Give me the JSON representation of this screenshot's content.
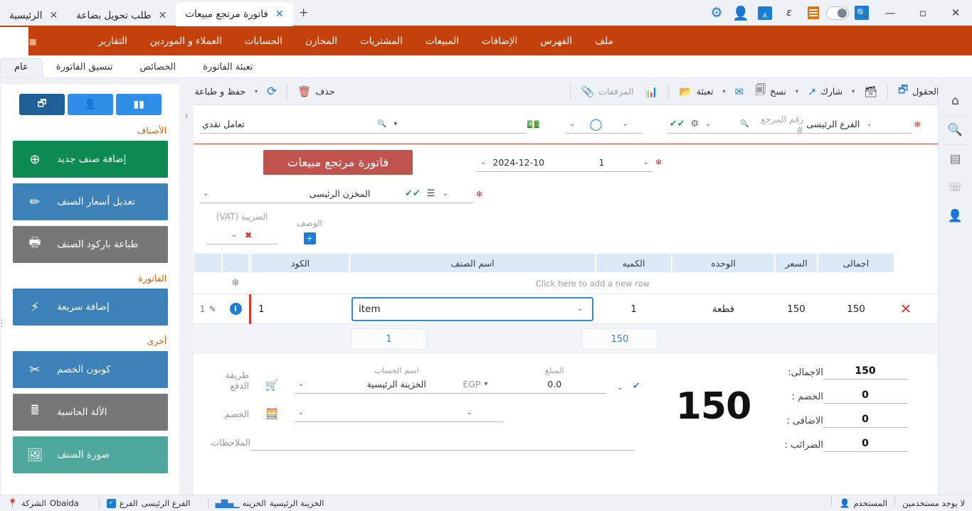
{
  "titlebar": {
    "window_controls": [
      "close",
      "maximize",
      "minimize"
    ],
    "quick_icons": [
      "search-icon",
      "toggle-switch",
      "list-orange-icon",
      "epsilon-icon",
      "translate-icon",
      "user-icon",
      "settings-gear-icon"
    ],
    "tabs": [
      {
        "label": "الرئيسية",
        "active": false
      },
      {
        "label": "طلب تحويل بضاعة",
        "active": false
      },
      {
        "label": "فاتورة مرتجع مبيعات",
        "active": true
      }
    ],
    "new_tab_label": "+"
  },
  "menubar": {
    "items": [
      "ملف",
      "الفهرس",
      "الإضافات",
      "المبيعات",
      "المشتريات",
      "المخازن",
      "الحسابات",
      "العملاء و الموردين",
      "التقارير"
    ]
  },
  "ribbon_tabs": [
    {
      "label": "عام",
      "active": true
    },
    {
      "label": "تنسيق الفاتورة",
      "active": false
    },
    {
      "label": "الخصائص",
      "active": false
    },
    {
      "label": "تعبئة الفاتورة",
      "active": false
    }
  ],
  "toolbar": {
    "new_label": "",
    "forward_label": "",
    "back_label": "",
    "zoom_label": "",
    "save_label": "حفظ",
    "save_print_label": "حفظ و طباعة",
    "refresh_label": "",
    "delete_label": "حذف",
    "attachments_label": "المرفقات",
    "chart_label": "",
    "fill_label": "تعبئة",
    "mail_label": "",
    "copy_label": "نسخ",
    "share_label": "شارك",
    "card_label": "",
    "choose_fields_label": "إختيار الحقول"
  },
  "rail": {
    "icons": [
      "home-icon",
      "search-icon",
      "report-icon",
      "phone-icon",
      "contact-icon"
    ]
  },
  "sidebar": {
    "tabs": [
      "chart-icon",
      "person-icon",
      "window-icon"
    ],
    "groups": [
      {
        "heading": "الأصناف",
        "buttons": [
          {
            "label": "إضافة صنف جديد",
            "icon": "plus-circle-icon",
            "color": "#0c8a52"
          },
          {
            "label": "تعديل أسعار الصنف",
            "icon": "pencil-icon",
            "color": "#3c81b8"
          },
          {
            "label": "طباعة باركود الصنف",
            "icon": "printer-icon",
            "color": "#777777"
          }
        ]
      },
      {
        "heading": "الفاتورة",
        "buttons": [
          {
            "label": "إضافة سريعة",
            "icon": "lightning-icon",
            "color": "#3c81b8"
          }
        ]
      },
      {
        "heading": "أخرى",
        "buttons": [
          {
            "label": "كوبون الخصم",
            "icon": "scissors-icon",
            "color": "#3c81b8"
          },
          {
            "label": "الألة الحاسبة",
            "icon": "calculator-icon",
            "color": "#777777"
          },
          {
            "label": "صورة الصنف",
            "icon": "image-icon",
            "color": "#4fa89c"
          }
        ]
      }
    ]
  },
  "form": {
    "title": "فاتورة مرتجع مبيعات",
    "row1": {
      "deal_type": "تعامل نقدي",
      "customer_placeholder": "",
      "money_icon": "banknote-icon",
      "circle_icon": "circle-icon",
      "check_icon": "double-check-icon",
      "gear_icon": "gear-icon",
      "reference_placeholder": "رقم المرجع #",
      "branch": "الفرع الرئيسى"
    },
    "row2": {
      "date": "2024-12-10",
      "serial": "1"
    },
    "row3": {
      "warehouse": "المخزن الرئيسى",
      "list_icon": "list-icon",
      "check_icon": "double-check-icon"
    },
    "row4": {
      "vat_label": "الضريبة (VAT)",
      "desc_label": "الوصف",
      "add_icon": "add-box-icon",
      "clear_icon": "clear-x-icon"
    }
  },
  "grid": {
    "headers": [
      "الكود",
      "اسم الصنف",
      "الكميه",
      "الوحده",
      "السعر",
      "اجمالى"
    ],
    "new_row_hint": "Click here to add a new row",
    "new_row_marker": "✻",
    "rows": [
      {
        "num": "1",
        "pencil_icon": "pencil-icon",
        "info_icon": "info-icon",
        "code": "1",
        "item_name": "item",
        "qty": "1",
        "unit": "قطعة",
        "price": "150",
        "total": "150",
        "delete_icon": "x-delete-icon"
      }
    ],
    "subtotals": {
      "qty": "1",
      "total": "150"
    }
  },
  "totals": {
    "big_total": "150",
    "rows": [
      {
        "label": "الاجمالى:",
        "value": "150"
      },
      {
        "label": "الخصم :",
        "value": "0"
      },
      {
        "label": "الاضافى :",
        "value": "0"
      },
      {
        "label": "الضرائب :",
        "value": "0"
      }
    ]
  },
  "payment": {
    "method_label": "طريقة الدفع",
    "method_icon": "cart-icon",
    "discount_label": "الخصم",
    "discount_icon": "calc-money-icon",
    "notes_label": "الملاحظات",
    "account_caption": "اسم الحساب",
    "account_value": "الخزينة الرئيسية",
    "currency": "EGP",
    "amount_caption": "المبلغ",
    "amount_value": "0.0",
    "check_icon": "check-icon"
  },
  "statusbar": {
    "company_label": "الشركة",
    "company_value": "Obaida",
    "branch_label": "الفرع",
    "branch_value": "الفرع الرئيسى",
    "treasury_label": "الخزينه",
    "treasury_value": "الخزينة الرئيسية",
    "user_label": "المستخدم",
    "user_value": "لا يوجد مستخدمين",
    "pin_icon": "location-pin-icon",
    "check_icon": "checkbox-checked-icon",
    "equalizer_icon": "equalizer-icon",
    "person_icon": "person-icon"
  },
  "colors": {
    "brand_orange": "#c4410b",
    "title_red": "#c0534d",
    "accent_blue": "#1a7fd4",
    "green": "#0c8a52",
    "header_blue": "#dce9f7"
  }
}
